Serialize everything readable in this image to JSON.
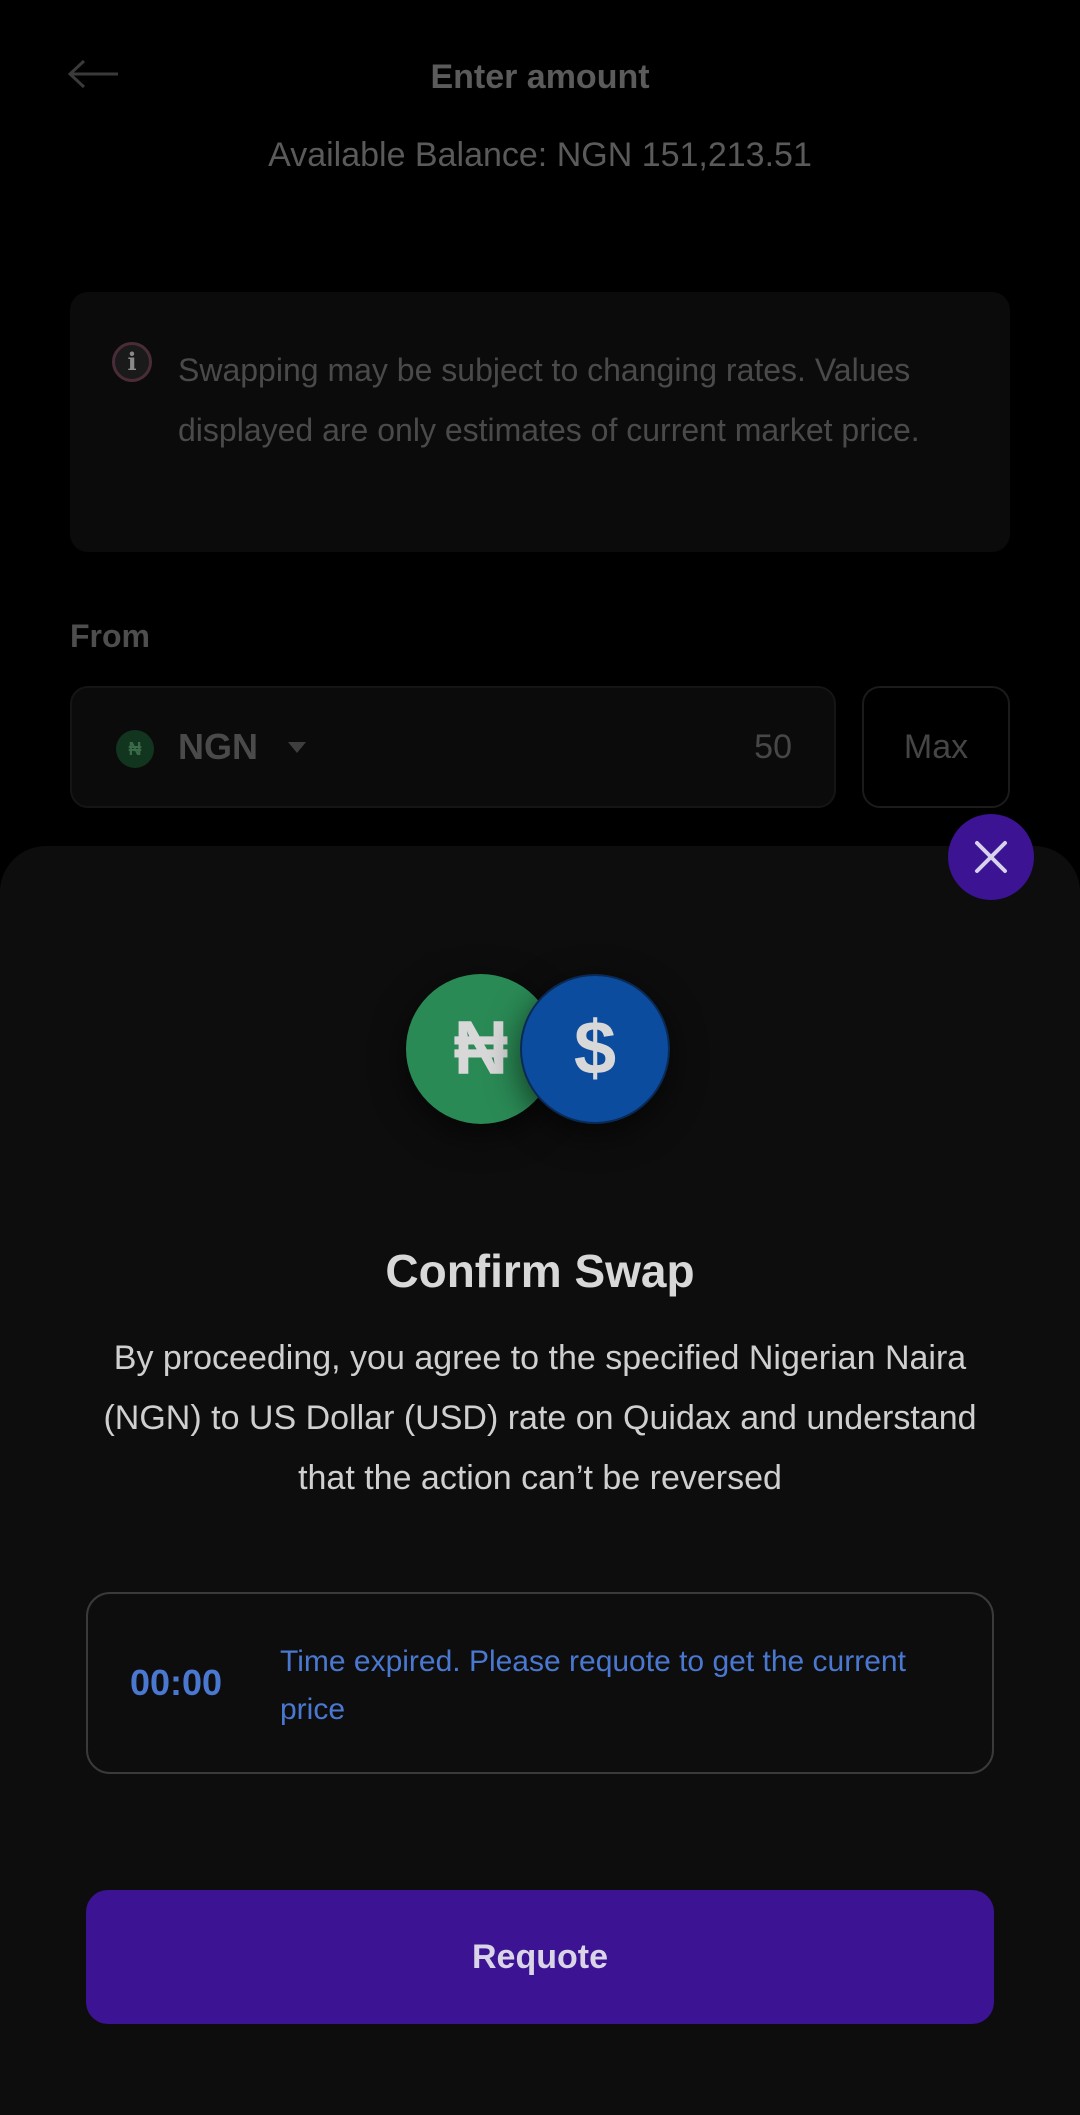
{
  "header": {
    "title": "Enter amount",
    "balance": "Available Balance: NGN 151,213.51",
    "back_icon": "arrow-left-icon"
  },
  "notice": {
    "icon": "info-icon",
    "icon_glyph": "i",
    "text": "Swapping may be subject to changing rates. Values displayed are only estimates of current market price."
  },
  "from": {
    "label": "From",
    "coin_glyph": "₦",
    "currency": "NGN",
    "amount": "50",
    "max_label": "Max"
  },
  "sheet": {
    "close_icon": "close-icon",
    "coins": {
      "ngn_glyph": "₦",
      "usd_glyph": "$"
    },
    "title": "Confirm Swap",
    "description": "By proceeding, you agree to the specified Nigerian Naira (NGN) to US Dollar (USD) rate on Quidax and understand that the action can’t be reversed",
    "timer": {
      "value": "00:00",
      "message": "Time expired. Please requote to get the current price"
    },
    "requote_label": "Requote"
  },
  "colors": {
    "accent_purple": "#3b1393",
    "timer_blue": "#4a78d1",
    "ngn_green": "#2a8a55",
    "usd_blue": "#0c4c9e"
  }
}
